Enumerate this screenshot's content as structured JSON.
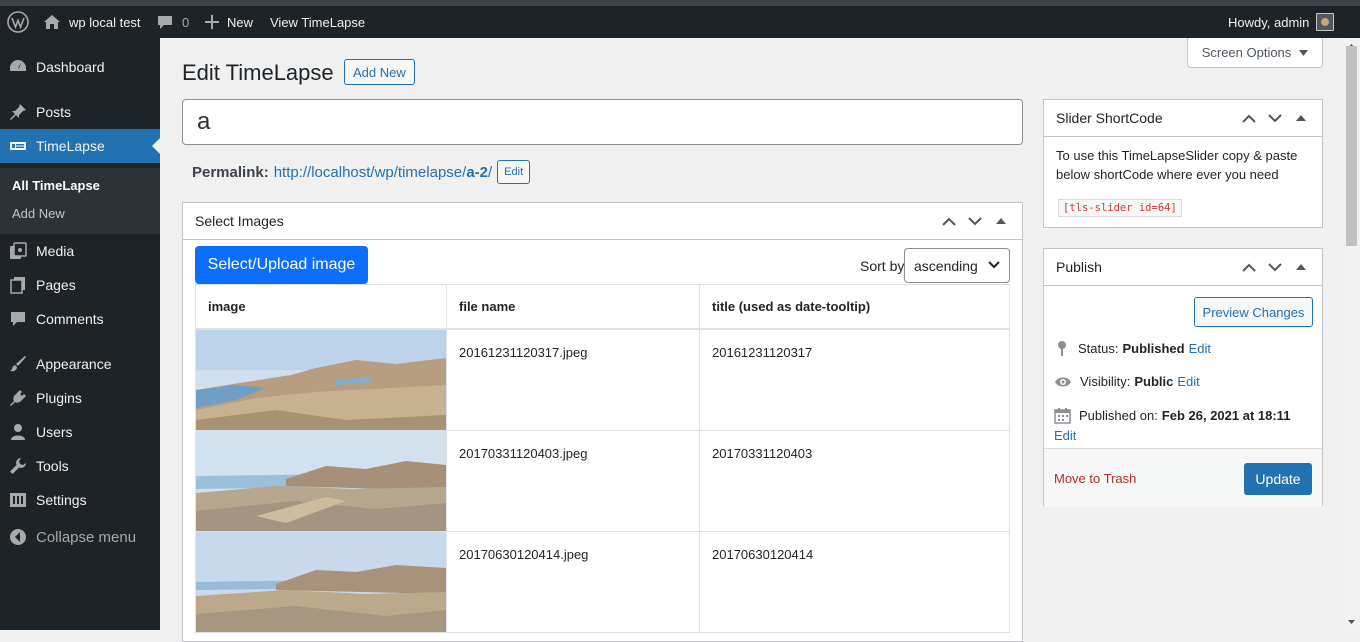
{
  "admin_bar": {
    "site_name": "wp local test",
    "comments_count": "0",
    "new_label": "New",
    "view_label": "View TimeLapse",
    "howdy": "Howdy, admin"
  },
  "sidebar": {
    "items": [
      {
        "label": "Dashboard",
        "icon": "dashboard-icon"
      },
      {
        "label": "Posts",
        "icon": "pin-icon"
      },
      {
        "label": "TimeLapse",
        "icon": "slides-icon",
        "active": true
      },
      {
        "label": "Media",
        "icon": "media-icon"
      },
      {
        "label": "Pages",
        "icon": "pages-icon"
      },
      {
        "label": "Comments",
        "icon": "comment-icon"
      },
      {
        "label": "Appearance",
        "icon": "brush-icon"
      },
      {
        "label": "Plugins",
        "icon": "plug-icon"
      },
      {
        "label": "Users",
        "icon": "user-icon"
      },
      {
        "label": "Tools",
        "icon": "wrench-icon"
      },
      {
        "label": "Settings",
        "icon": "settings-icon"
      },
      {
        "label": "Collapse menu",
        "icon": "collapse-icon"
      }
    ],
    "submenu": [
      {
        "label": "All TimeLapse",
        "current": true
      },
      {
        "label": "Add New"
      }
    ]
  },
  "screen_options": "Screen Options",
  "page": {
    "title": "Edit TimeLapse",
    "add_new": "Add New",
    "post_title": "a",
    "permalink_label": "Permalink:",
    "permalink_base": "http://localhost/wp/timelapse/",
    "permalink_slug": "a-2",
    "permalink_trail": "/",
    "permalink_edit": "Edit"
  },
  "select_images": {
    "title": "Select Images",
    "upload_button": "Select/Upload image",
    "sort_label": "Sort by:",
    "sort_value": "ascending",
    "columns": [
      "image",
      "file name",
      "title (used as date-tooltip)"
    ],
    "rows": [
      {
        "file": "20161231120317.jpeg",
        "title": "20161231120317"
      },
      {
        "file": "20170331120403.jpeg",
        "title": "20170331120403"
      },
      {
        "file": "20170630120414.jpeg",
        "title": "20170630120414"
      }
    ]
  },
  "shortcode_box": {
    "title": "Slider ShortCode",
    "description": "To use this TimeLapseSlider copy & paste below shortCode where ever you need",
    "code": "[tls-slider id=64]"
  },
  "publish_box": {
    "title": "Publish",
    "preview_button": "Preview Changes",
    "status_label": "Status:",
    "status_value": "Published",
    "visibility_label": "Visibility:",
    "visibility_value": "Public",
    "published_label": "Published on:",
    "published_value": "Feb 26, 2021 at 18:11",
    "edit_label": "Edit",
    "trash_label": "Move to Trash",
    "update_button": "Update"
  }
}
